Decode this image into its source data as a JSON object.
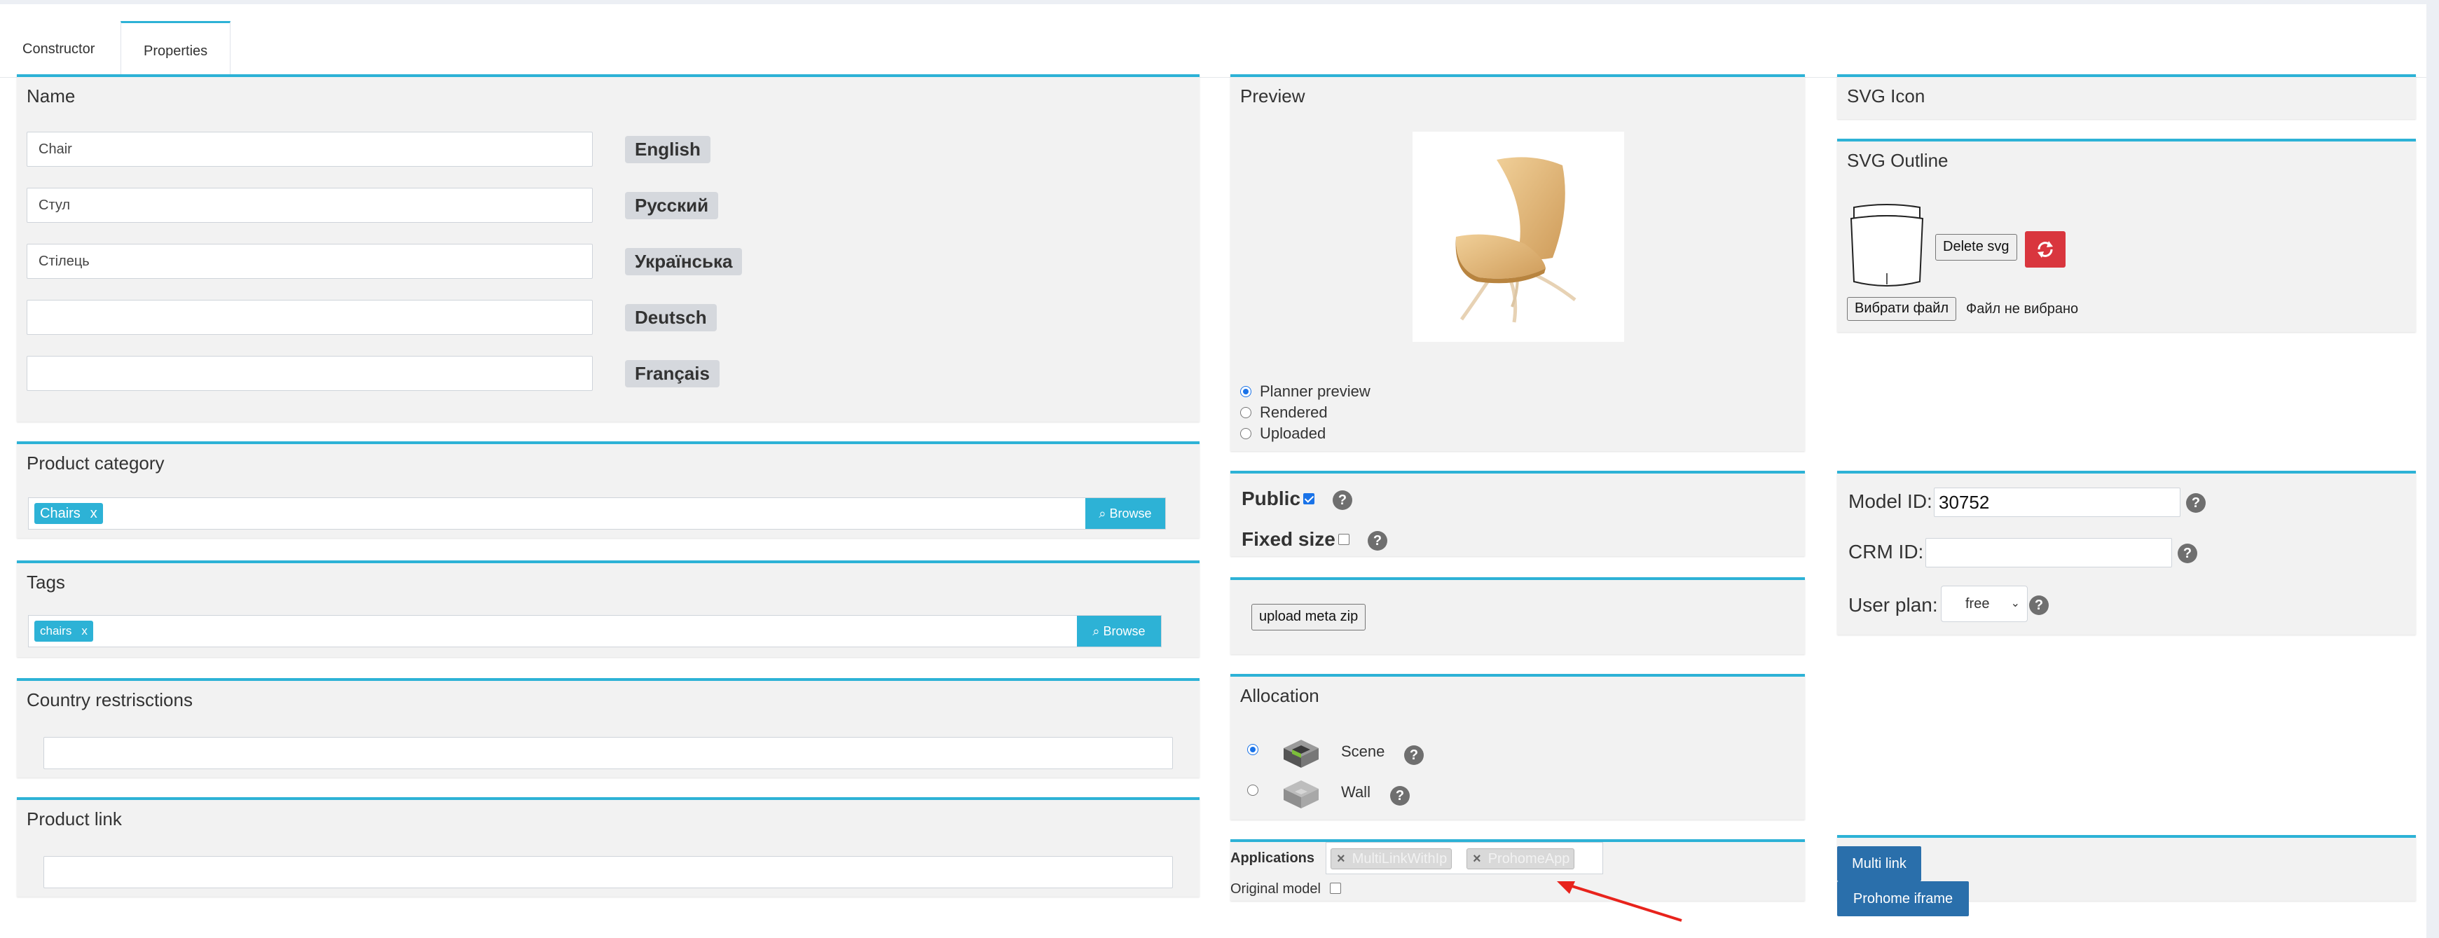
{
  "tabs": [
    {
      "label": "Constructor",
      "active": false
    },
    {
      "label": "Properties",
      "active": true
    }
  ],
  "name_panel": {
    "title": "Name",
    "rows": [
      {
        "value": "Chair",
        "language": "English"
      },
      {
        "value": "Стул",
        "language": "Русский"
      },
      {
        "value": "Стілець",
        "language": "Українська"
      },
      {
        "value": "",
        "language": "Deutsch"
      },
      {
        "value": "",
        "language": "Français"
      }
    ]
  },
  "product_category": {
    "title": "Product category",
    "chip": "Chairs",
    "chip_remove": "x",
    "browse": "Browse"
  },
  "tags": {
    "title": "Tags",
    "chip": "chairs",
    "chip_remove": "x",
    "browse": "Browse"
  },
  "country_restrictions": {
    "title": "Country restrisctions",
    "value": ""
  },
  "product_link": {
    "title": "Product link",
    "value": ""
  },
  "preview": {
    "title": "Preview",
    "options": [
      {
        "label": "Planner preview",
        "selected": true
      },
      {
        "label": "Rendered",
        "selected": false
      },
      {
        "label": "Uploaded",
        "selected": false
      }
    ]
  },
  "visibility": {
    "public_label": "Public",
    "public_checked": true,
    "fixed_label": "Fixed size",
    "fixed_checked": false,
    "help": "?"
  },
  "upload": {
    "label": "upload meta zip"
  },
  "allocation": {
    "title": "Allocation",
    "options": [
      {
        "label": "Scene",
        "selected": true
      },
      {
        "label": "Wall",
        "selected": false
      }
    ]
  },
  "applications": {
    "label": "Applications",
    "chips": [
      "MultiLinkWithIp",
      "ProhomeApp"
    ],
    "chip_remove": "×",
    "original_model_label": "Original model",
    "original_model_checked": false
  },
  "svg_icon": {
    "title": "SVG Icon"
  },
  "svg_outline": {
    "title": "SVG Outline",
    "delete_label": "Delete svg",
    "choose_file": "Вибрати файл",
    "no_file": "Файл не вибрано"
  },
  "ids": {
    "model_label": "Model ID:",
    "model_value": "30752",
    "crm_label": "CRM ID:",
    "crm_value": "",
    "plan_label": "User plan:",
    "plan_value": "free"
  },
  "links": {
    "multi": "Multi link",
    "iframe": "Prohome iframe"
  },
  "colors": {
    "accent": "#2db2d6",
    "danger": "#d9363e",
    "link_button": "#2a6fab"
  }
}
